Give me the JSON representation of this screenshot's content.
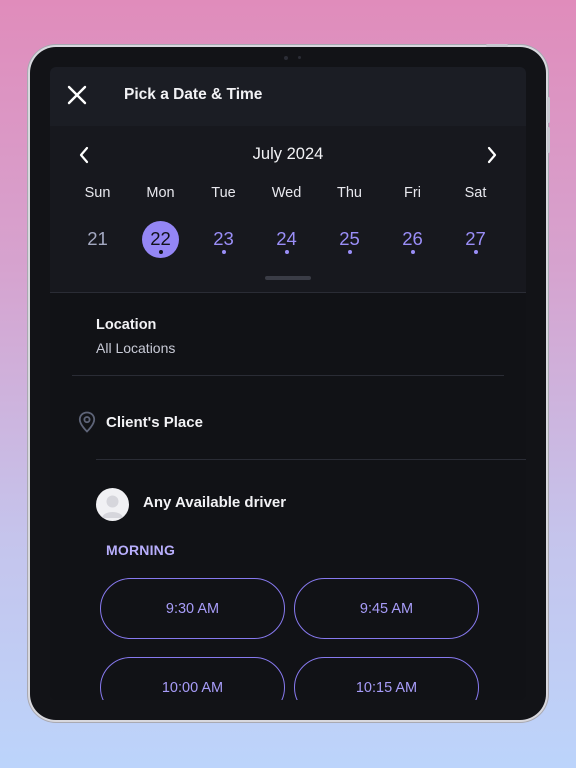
{
  "header": {
    "title": "Pick a Date & Time"
  },
  "icons": {
    "close": "close-icon",
    "prev": "chevron-left-icon",
    "next": "chevron-right-icon",
    "location": "map-pin-icon",
    "avatar": "user-avatar-icon"
  },
  "calendar": {
    "month_label": "July 2024",
    "weekdays": [
      "Sun",
      "Mon",
      "Tue",
      "Wed",
      "Thu",
      "Fri",
      "Sat"
    ],
    "dates": [
      "21",
      "22",
      "23",
      "24",
      "25",
      "26",
      "27"
    ],
    "selected_date": "22"
  },
  "location": {
    "label": "Location",
    "value": "All Locations"
  },
  "place": {
    "label": "Client's Place"
  },
  "driver": {
    "label": "Any  Available driver"
  },
  "morning": {
    "title": "MORNING",
    "slots": [
      "9:30 AM",
      "9:45 AM",
      "10:00 AM",
      "10:15 AM"
    ]
  },
  "colors": {
    "accent": "#9486f5",
    "background": "#111216",
    "header": "#1b1d24"
  }
}
